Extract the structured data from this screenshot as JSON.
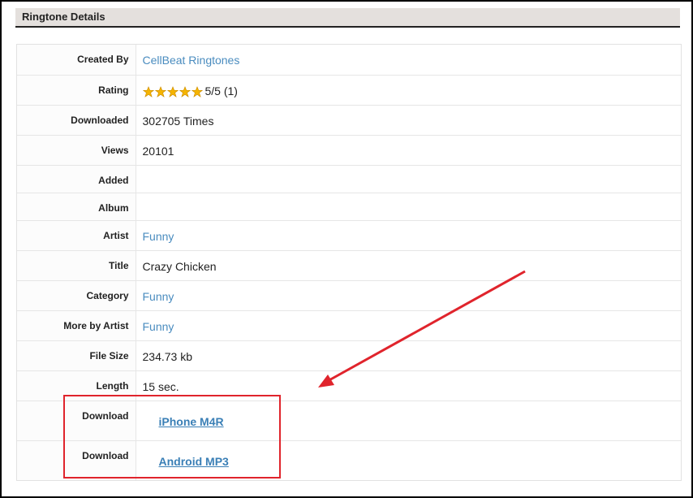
{
  "panel": {
    "title": "Ringtone Details"
  },
  "rows": [
    {
      "label": "Created By",
      "value": "CellBeat Ringtones",
      "link": true
    },
    {
      "label": "Rating",
      "value": "5/5 (1)",
      "stars": 5
    },
    {
      "label": "Downloaded",
      "value": "302705 Times"
    },
    {
      "label": "Views",
      "value": "20101"
    },
    {
      "label": "Added",
      "value": ""
    },
    {
      "label": "Album",
      "value": ""
    },
    {
      "label": "Artist",
      "value": "Funny",
      "link": true
    },
    {
      "label": "Title",
      "value": "Crazy Chicken"
    },
    {
      "label": "Category",
      "value": "Funny",
      "link": true
    },
    {
      "label": "More by Artist",
      "value": "Funny",
      "link": true
    },
    {
      "label": "File Size",
      "value": "234.73 kb"
    },
    {
      "label": "Length",
      "value": "15 sec."
    },
    {
      "label": "Download",
      "value": "iPhone M4R",
      "link": true
    },
    {
      "label": "Download",
      "value": "Android MP3",
      "link": true
    }
  ],
  "colors": {
    "link": "#4a8cbf",
    "annotation": "#e0242c",
    "star": "#f5b400"
  },
  "icons": {
    "rating": "star-icon",
    "annotation": "arrow-icon"
  }
}
